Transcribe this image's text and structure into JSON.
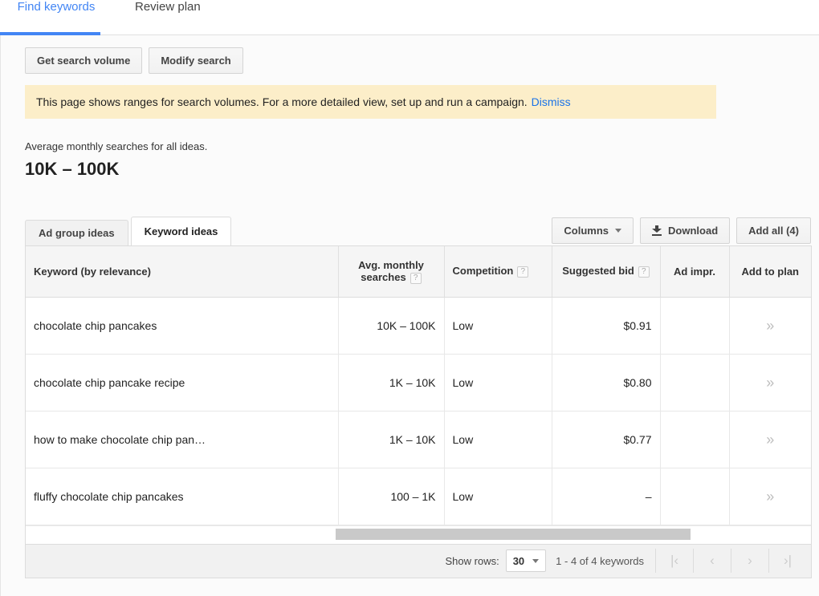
{
  "topnav": {
    "items": [
      {
        "label": "Find keywords",
        "active": true
      },
      {
        "label": "Review plan",
        "active": false
      }
    ]
  },
  "actions": {
    "get_search_volume": "Get search volume",
    "modify_search": "Modify search"
  },
  "notice": {
    "text": "This page shows ranges for search volumes. For a more detailed view, set up and run a campaign.",
    "dismiss": "Dismiss",
    "background": "#fceec9",
    "link_color": "#1a73e8"
  },
  "summary": {
    "label": "Average monthly searches for all ideas.",
    "value": "10K – 100K"
  },
  "card": {
    "tabs": [
      {
        "label": "Ad group ideas",
        "active": false
      },
      {
        "label": "Keyword ideas",
        "active": true
      }
    ],
    "toolbar": {
      "columns": "Columns",
      "download": "Download",
      "add_all": "Add all (4)"
    }
  },
  "table": {
    "columns": [
      {
        "label": "Keyword (by relevance)",
        "help": false
      },
      {
        "label": "Avg. monthly searches",
        "help": true,
        "help_glyph": "?"
      },
      {
        "label": "Competition",
        "help": true,
        "help_glyph": "?"
      },
      {
        "label": "Suggested bid",
        "help": true,
        "help_glyph": "?"
      },
      {
        "label": "Ad impr.",
        "help": false
      },
      {
        "label": "Add to plan",
        "help": false
      }
    ],
    "rows": [
      {
        "keyword": "chocolate chip pancakes",
        "avg_monthly_searches": "10K – 100K",
        "competition": "Low",
        "suggested_bid": "$0.91",
        "ad_impr": "",
        "add_glyph": "»"
      },
      {
        "keyword": "chocolate chip pancake recipe",
        "avg_monthly_searches": "1K – 10K",
        "competition": "Low",
        "suggested_bid": "$0.80",
        "ad_impr": "",
        "add_glyph": "»"
      },
      {
        "keyword": "how to make chocolate chip pan…",
        "avg_monthly_searches": "1K – 10K",
        "competition": "Low",
        "suggested_bid": "$0.77",
        "ad_impr": "",
        "add_glyph": "»"
      },
      {
        "keyword": "fluffy chocolate chip pancakes",
        "avg_monthly_searches": "100 – 1K",
        "competition": "Low",
        "suggested_bid": "–",
        "ad_impr": "",
        "add_glyph": "»"
      }
    ]
  },
  "footer": {
    "show_rows_label": "Show rows:",
    "rows_per_page": "30",
    "range_text": "1 - 4 of 4 keywords",
    "pagination": [
      {
        "name": "first",
        "glyph": "|‹"
      },
      {
        "name": "previous",
        "glyph": "‹"
      },
      {
        "name": "next",
        "glyph": "›"
      },
      {
        "name": "last",
        "glyph": "›|"
      }
    ]
  }
}
